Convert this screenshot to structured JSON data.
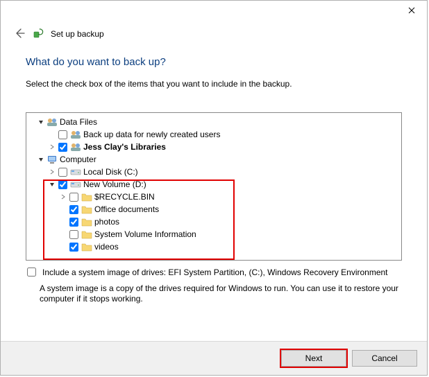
{
  "window": {
    "title": "Set up backup"
  },
  "heading": "What do you want to back up?",
  "instruction": "Select the check box of the items that you want to include in the backup.",
  "tree": {
    "data_files": {
      "label": "Data Files",
      "new_users": "Back up data for newly created users",
      "jess_libraries": "Jess Clay's Libraries"
    },
    "computer": {
      "label": "Computer",
      "local_disk": "Local Disk (C:)",
      "new_volume": {
        "label": "New Volume (D:)",
        "recycle": "$RECYCLE.BIN",
        "office": "Office documents",
        "photos": "photos",
        "svi": "System Volume Information",
        "videos": "videos"
      }
    }
  },
  "option": {
    "include_image": "Include a system image of drives: EFI System Partition, (C:), Windows Recovery Environment",
    "note": "A system image is a copy of the drives required for Windows to run. You can use it to restore your computer if it stops working."
  },
  "buttons": {
    "next": "Next",
    "cancel": "Cancel"
  }
}
